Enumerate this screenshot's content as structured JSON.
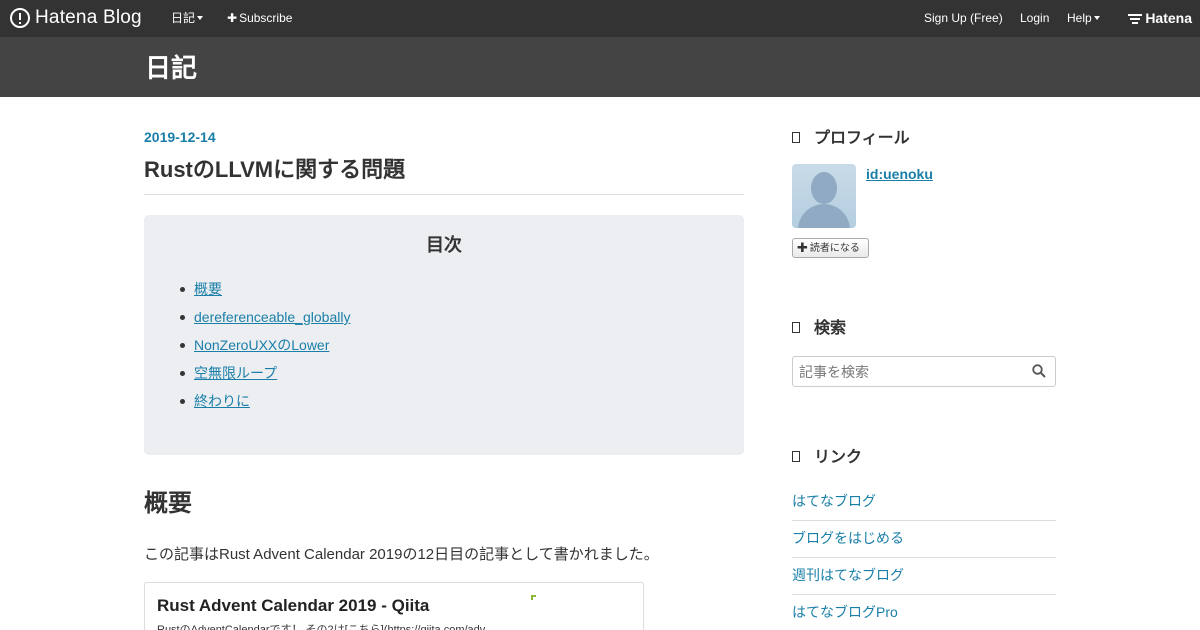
{
  "globalheader": {
    "logo_text": "Hatena Blog",
    "menu_label": "日記",
    "subscribe_label": "Subscribe",
    "signup_label": "Sign Up (Free)",
    "login_label": "Login",
    "help_label": "Help",
    "brand_label": "Hatena"
  },
  "blog": {
    "title": "日記"
  },
  "entry": {
    "date": "2019-12-14",
    "title": "RustのLLVMに関する問題",
    "toc": {
      "title": "目次",
      "items": [
        {
          "label": "概要"
        },
        {
          "label": "dereferenceable_globally"
        },
        {
          "label": "NonZeroUXXのLower"
        },
        {
          "label": "空無限ループ"
        },
        {
          "label": "終わりに"
        }
      ]
    },
    "section_heading": "概要",
    "paragraph": "この記事はRust Advent Calendar 2019の12日目の記事として書かれました。",
    "embed": {
      "title": "Rust Advent Calendar 2019 - Qiita",
      "description": "RustのAdventCalendarです！ その2は[こちら](https://qiita.com/adv"
    }
  },
  "sidebar": {
    "profile": {
      "title": "プロフィール",
      "user_id": "id:uenoku",
      "subscribe_button": "読者になる"
    },
    "search": {
      "title": "検索",
      "placeholder": "記事を検索"
    },
    "links": {
      "title": "リンク",
      "items": [
        {
          "label": "はてなブログ"
        },
        {
          "label": "ブログをはじめる"
        },
        {
          "label": "週刊はてなブログ"
        },
        {
          "label": "はてなブログPro"
        }
      ]
    }
  },
  "colors": {
    "header_bg": "#333333",
    "blog_header_bg": "#444444",
    "link": "#1a7fa8",
    "toc_bg": "#eceef1"
  }
}
